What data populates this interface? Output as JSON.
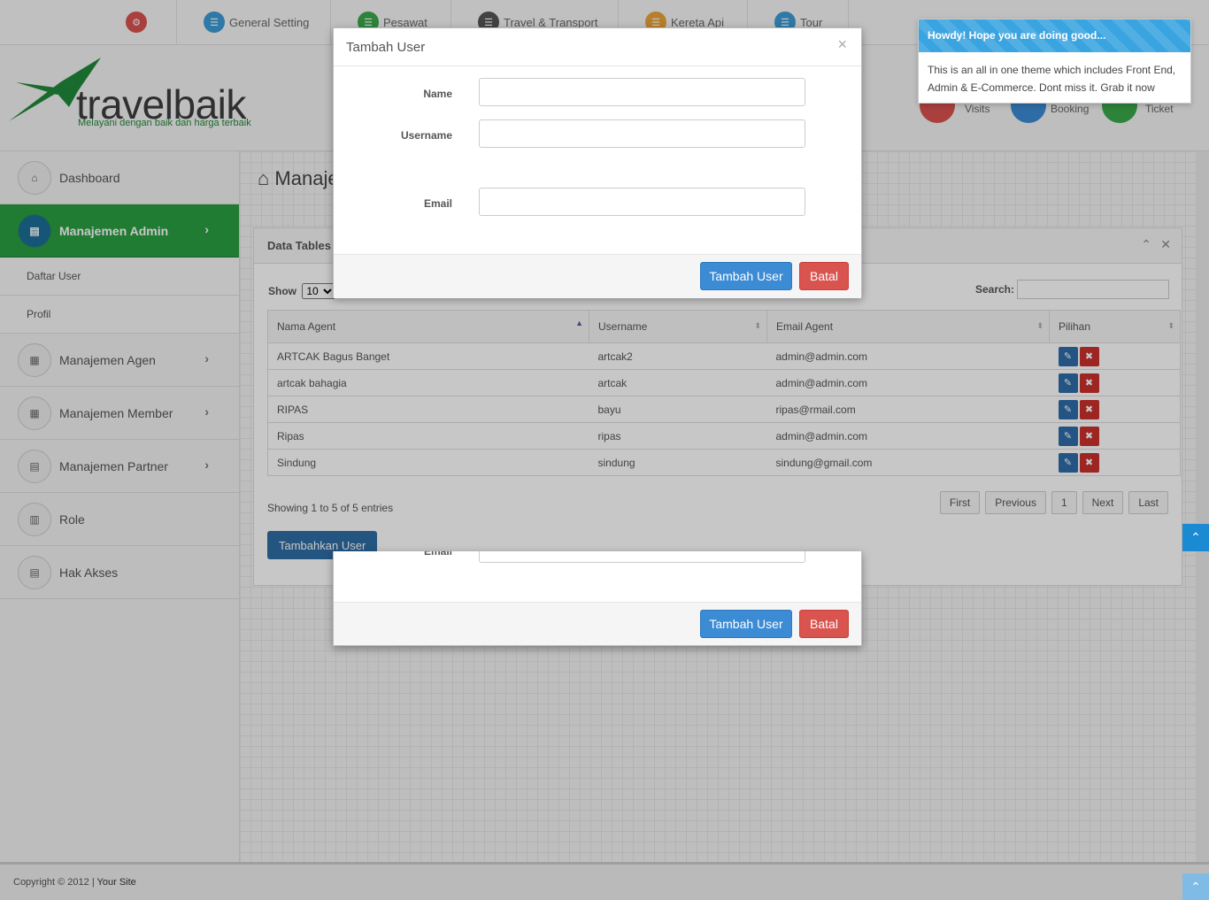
{
  "topnav": {
    "items": [
      {
        "label": "",
        "icon": "share-icon",
        "color": "#d9534f"
      },
      {
        "label": "General Setting",
        "icon": "building-icon",
        "color": "#3b9bd5"
      },
      {
        "label": "Pesawat",
        "icon": "building-icon",
        "color": "#3aa84b"
      },
      {
        "label": "Travel & Transport",
        "icon": "building-icon",
        "color": "#555555"
      },
      {
        "label": "Kereta Api",
        "icon": "building-icon",
        "color": "#e8a33a"
      },
      {
        "label": "Tour",
        "icon": "building-icon",
        "color": "#3b9bd5"
      }
    ]
  },
  "header": {
    "logo_text": "travelbaik",
    "tagline": "Melayani dengan baik dan harga terbaik",
    "stats": [
      {
        "label": "Visits",
        "color": "#d9534f"
      },
      {
        "label": "Booking",
        "color": "#3b8bd5"
      },
      {
        "label": "Ticket",
        "color": "#3aa84b"
      }
    ]
  },
  "sidebar": {
    "items": [
      {
        "label": "Dashboard",
        "icon": "home-icon"
      },
      {
        "label": "Manajemen Admin",
        "icon": "list-icon",
        "active": true
      },
      {
        "label": "Daftar User"
      },
      {
        "label": "Profil"
      },
      {
        "label": "Manajemen Agen",
        "icon": "table-icon"
      },
      {
        "label": "Manajemen Member",
        "icon": "table-icon"
      },
      {
        "label": "Manajemen Partner",
        "icon": "list-icon"
      },
      {
        "label": "Role",
        "icon": "chart-icon"
      },
      {
        "label": "Hak Akses",
        "icon": "list-icon"
      }
    ]
  },
  "main": {
    "page_title": "Manajemen Admin",
    "panel_title": "Data Tables",
    "show_label": "Show",
    "show_value": "10",
    "search_label": "Search:",
    "columns": [
      "Nama Agent",
      "Username",
      "Email Agent",
      "Pilihan"
    ],
    "rows": [
      [
        "ARTCAK Bagus Banget",
        "artcak2",
        "admin@admin.com"
      ],
      [
        "artcak bahagia",
        "artcak",
        "admin@admin.com"
      ],
      [
        "RIPAS",
        "bayu",
        "ripas@rmail.com"
      ],
      [
        "Ripas",
        "ripas",
        "admin@admin.com"
      ],
      [
        "Sindung",
        "sindung",
        "sindung@gmail.com"
      ]
    ],
    "info": "Showing 1 to 5 of 5 entries",
    "pager": [
      "First",
      "Previous",
      "1",
      "Next",
      "Last"
    ],
    "add_button": "Tambahkan User"
  },
  "modal": {
    "title": "Tambah User",
    "close": "×",
    "name_label": "Name",
    "username_label": "Username",
    "email_label": "Email",
    "submit": "Tambah User",
    "cancel": "Batal"
  },
  "notification": {
    "title": "Howdy! Hope you are doing good...",
    "body": "This is an all in one theme which includes Front End, Admin & E-Commerce. Dont miss it. Grab it now"
  },
  "footer": {
    "copyright": "Copyright © 2012 |",
    "site": "Your Site"
  }
}
